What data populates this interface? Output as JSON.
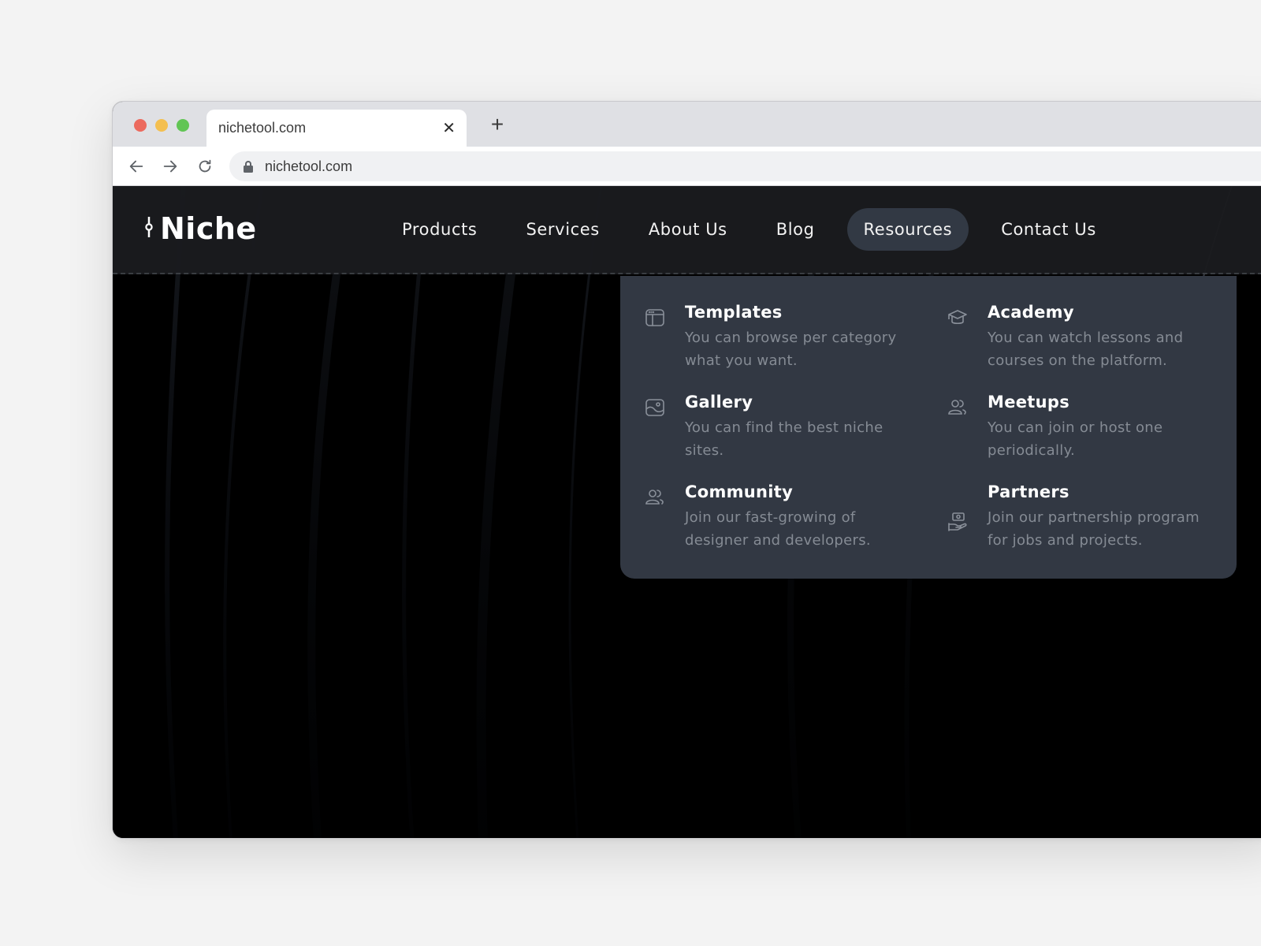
{
  "browser": {
    "tab": {
      "title": "nichetool.com",
      "close_icon": "close-icon"
    },
    "new_tab_icon": "plus-icon",
    "toolbar": {
      "back_icon": "arrow-left-icon",
      "forward_icon": "arrow-right-icon",
      "reload_icon": "reload-icon",
      "lock_icon": "lock-icon",
      "url": "nichetool.com"
    }
  },
  "site": {
    "logo": {
      "text": "Niche",
      "icon": "logo-mark-icon"
    },
    "nav": [
      {
        "label": "Products",
        "active": false
      },
      {
        "label": "Services",
        "active": false
      },
      {
        "label": "About Us",
        "active": false
      },
      {
        "label": "Blog",
        "active": false
      },
      {
        "label": "Resources",
        "active": true
      },
      {
        "label": "Contact Us",
        "active": false
      }
    ],
    "resources_menu": [
      {
        "icon": "browser-window-icon",
        "title": "Templates",
        "description": "You can browse per category what you want."
      },
      {
        "icon": "graduation-cap-icon",
        "title": "Academy",
        "description": "You can watch lessons and courses on the platform."
      },
      {
        "icon": "image-icon",
        "title": "Gallery",
        "description": "You can find the best niche sites."
      },
      {
        "icon": "users-icon",
        "title": "Meetups",
        "description": "You can join or host one periodically."
      },
      {
        "icon": "users-icon",
        "title": "Community",
        "description": "Join our fast-growing of designer and developers."
      },
      {
        "icon": "hand-money-icon",
        "title": "Partners",
        "description": "Join our partnership program for jobs and projects."
      }
    ]
  },
  "colors": {
    "page_bg": "#f3f3f3",
    "header_bg": "#1a1b1e",
    "dropdown_bg": "#323843",
    "active_nav_bg": "#323944",
    "desc_text": "#858b94"
  }
}
